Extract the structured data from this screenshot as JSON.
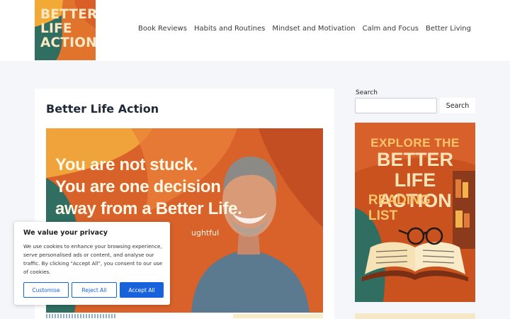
{
  "logo": {
    "lines": [
      "BETTER",
      "LIFE",
      "ACTION"
    ]
  },
  "nav": {
    "items": [
      "Book Reviews",
      "Habits and Routines",
      "Mindset and Motivation",
      "Calm and Focus",
      "Better Living"
    ]
  },
  "main": {
    "title": "Better Life Action",
    "hero": {
      "lines": [
        "You are not stuck.",
        "You are one decision",
        "away from a Better Life."
      ],
      "sub_partial": "ughtful"
    }
  },
  "sidebar": {
    "search_label": "Search",
    "search_placeholder": "",
    "search_button": "Search",
    "promo": {
      "line1": "EXPLORE THE",
      "line2a": "BETTER LIFE",
      "line2b": "ACTION",
      "line3a": "READING",
      "line3b": "LIST"
    }
  },
  "cookie": {
    "title": "We value your privacy",
    "body": "We use cookies to enhance your browsing experience, serve personalised ads or content, and analyse our traffic. By clicking \"Accept All\", you consent to our use of cookies.",
    "customise": "Customise",
    "reject": "Reject All",
    "accept": "Accept All"
  },
  "colors": {
    "accent": "#1863dc",
    "hero_orange": "#d9612a",
    "logo_green": "#2f6e60",
    "promo_orange": "#c9521f"
  }
}
